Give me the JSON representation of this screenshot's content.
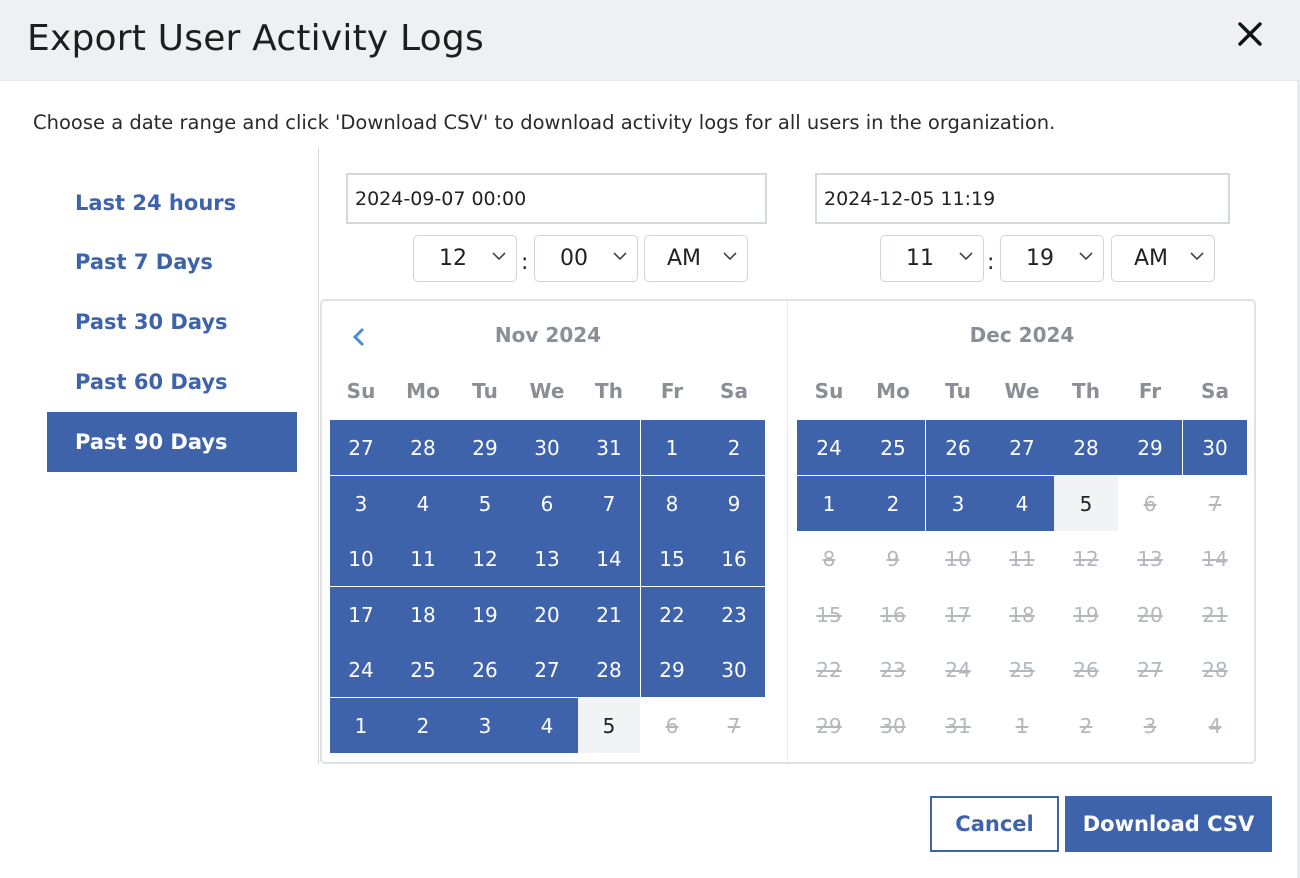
{
  "dialog": {
    "title": "Export User Activity Logs",
    "description": "Choose a date range and click 'Download CSV' to download activity logs for all users in the organization.",
    "close_icon": "close-icon"
  },
  "presets": [
    {
      "label": "Last 24 hours",
      "active": false
    },
    {
      "label": "Past 7 Days",
      "active": false
    },
    {
      "label": "Past 30 Days",
      "active": false
    },
    {
      "label": "Past 60 Days",
      "active": false
    },
    {
      "label": "Past 90 Days",
      "active": true
    }
  ],
  "start": {
    "datetime": "2024-09-07 00:00",
    "hour": "12",
    "minute": "00",
    "ampm": "AM"
  },
  "end": {
    "datetime": "2024-12-05 11:19",
    "hour": "11",
    "minute": "19",
    "ampm": "AM"
  },
  "time_separator": ":",
  "weekdays": [
    "Su",
    "Mo",
    "Tu",
    "We",
    "Th",
    "Fr",
    "Sa"
  ],
  "calendars": [
    {
      "title": "Nov 2024",
      "days": [
        {
          "d": "27",
          "s": "range"
        },
        {
          "d": "28",
          "s": "range"
        },
        {
          "d": "29",
          "s": "range"
        },
        {
          "d": "30",
          "s": "range"
        },
        {
          "d": "31",
          "s": "range"
        },
        {
          "d": "1",
          "s": "range"
        },
        {
          "d": "2",
          "s": "range"
        },
        {
          "d": "3",
          "s": "range"
        },
        {
          "d": "4",
          "s": "range"
        },
        {
          "d": "5",
          "s": "range"
        },
        {
          "d": "6",
          "s": "range"
        },
        {
          "d": "7",
          "s": "range"
        },
        {
          "d": "8",
          "s": "range"
        },
        {
          "d": "9",
          "s": "range"
        },
        {
          "d": "10",
          "s": "range"
        },
        {
          "d": "11",
          "s": "range"
        },
        {
          "d": "12",
          "s": "range"
        },
        {
          "d": "13",
          "s": "range"
        },
        {
          "d": "14",
          "s": "range"
        },
        {
          "d": "15",
          "s": "range"
        },
        {
          "d": "16",
          "s": "range"
        },
        {
          "d": "17",
          "s": "range"
        },
        {
          "d": "18",
          "s": "range"
        },
        {
          "d": "19",
          "s": "range"
        },
        {
          "d": "20",
          "s": "range"
        },
        {
          "d": "21",
          "s": "range"
        },
        {
          "d": "22",
          "s": "range"
        },
        {
          "d": "23",
          "s": "range"
        },
        {
          "d": "24",
          "s": "range"
        },
        {
          "d": "25",
          "s": "range"
        },
        {
          "d": "26",
          "s": "range"
        },
        {
          "d": "27",
          "s": "range"
        },
        {
          "d": "28",
          "s": "range"
        },
        {
          "d": "29",
          "s": "range"
        },
        {
          "d": "30",
          "s": "range"
        },
        {
          "d": "1",
          "s": "range"
        },
        {
          "d": "2",
          "s": "range"
        },
        {
          "d": "3",
          "s": "range"
        },
        {
          "d": "4",
          "s": "range"
        },
        {
          "d": "5",
          "s": "today"
        },
        {
          "d": "6",
          "s": "disabled"
        },
        {
          "d": "7",
          "s": "disabled"
        }
      ]
    },
    {
      "title": "Dec 2024",
      "days": [
        {
          "d": "24",
          "s": "range"
        },
        {
          "d": "25",
          "s": "range"
        },
        {
          "d": "26",
          "s": "range"
        },
        {
          "d": "27",
          "s": "range"
        },
        {
          "d": "28",
          "s": "range"
        },
        {
          "d": "29",
          "s": "range"
        },
        {
          "d": "30",
          "s": "range"
        },
        {
          "d": "1",
          "s": "range"
        },
        {
          "d": "2",
          "s": "range"
        },
        {
          "d": "3",
          "s": "range"
        },
        {
          "d": "4",
          "s": "range"
        },
        {
          "d": "5",
          "s": "today"
        },
        {
          "d": "6",
          "s": "disabled"
        },
        {
          "d": "7",
          "s": "disabled"
        },
        {
          "d": "8",
          "s": "disabled"
        },
        {
          "d": "9",
          "s": "disabled"
        },
        {
          "d": "10",
          "s": "disabled"
        },
        {
          "d": "11",
          "s": "disabled"
        },
        {
          "d": "12",
          "s": "disabled"
        },
        {
          "d": "13",
          "s": "disabled"
        },
        {
          "d": "14",
          "s": "disabled"
        },
        {
          "d": "15",
          "s": "disabled"
        },
        {
          "d": "16",
          "s": "disabled"
        },
        {
          "d": "17",
          "s": "disabled"
        },
        {
          "d": "18",
          "s": "disabled"
        },
        {
          "d": "19",
          "s": "disabled"
        },
        {
          "d": "20",
          "s": "disabled"
        },
        {
          "d": "21",
          "s": "disabled"
        },
        {
          "d": "22",
          "s": "disabled"
        },
        {
          "d": "23",
          "s": "disabled"
        },
        {
          "d": "24",
          "s": "disabled"
        },
        {
          "d": "25",
          "s": "disabled"
        },
        {
          "d": "26",
          "s": "disabled"
        },
        {
          "d": "27",
          "s": "disabled"
        },
        {
          "d": "28",
          "s": "disabled"
        },
        {
          "d": "29",
          "s": "disabled"
        },
        {
          "d": "30",
          "s": "disabled"
        },
        {
          "d": "31",
          "s": "disabled"
        },
        {
          "d": "1",
          "s": "disabled"
        },
        {
          "d": "2",
          "s": "disabled"
        },
        {
          "d": "3",
          "s": "disabled"
        },
        {
          "d": "4",
          "s": "disabled"
        }
      ]
    }
  ],
  "footer": {
    "cancel_label": "Cancel",
    "download_label": "Download CSV"
  },
  "colors": {
    "accent": "#3f63ab",
    "header_bg": "#eef0f3",
    "today_bg": "#f2f3f4",
    "disabled_text": "#b4b8bd"
  }
}
